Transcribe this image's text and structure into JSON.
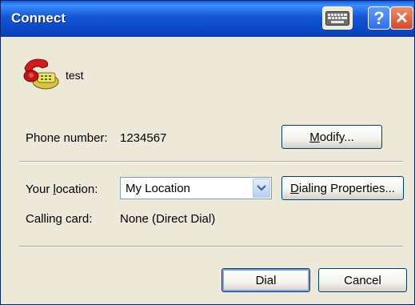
{
  "window": {
    "title": "Connect"
  },
  "titlebar_buttons": {
    "help_glyph": "?",
    "close_glyph": "✕"
  },
  "connection": {
    "name": "test",
    "icon": "phone-icon"
  },
  "phone": {
    "label_pre": "Phone number:",
    "value": "1234567"
  },
  "modify_button": {
    "pre": "",
    "u": "M",
    "post": "odify..."
  },
  "location": {
    "label_pre": "Your ",
    "label_u": "l",
    "label_post": "ocation:",
    "value": "My Location"
  },
  "dialing_button": {
    "pre": "",
    "u": "D",
    "post": "ialing Properties..."
  },
  "calling_card": {
    "label": "Calling card:",
    "value": "None (Direct Dial)"
  },
  "dial_button": {
    "label": "Dial"
  },
  "cancel_button": {
    "label": "Cancel"
  },
  "colors": {
    "title_bar": "#0b48c7",
    "window_bg": "#ece9d8",
    "button_border": "#003c74"
  }
}
